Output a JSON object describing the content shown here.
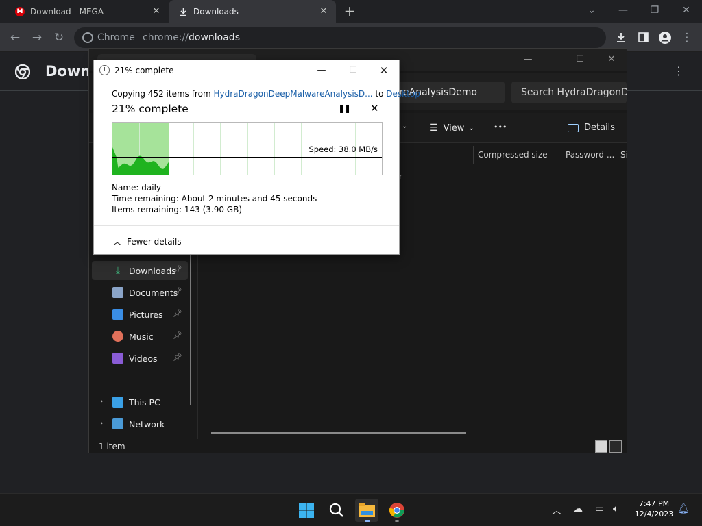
{
  "browser": {
    "tabs": [
      {
        "label": "Download - MEGA",
        "icon": "mega-icon"
      },
      {
        "label": "Downloads",
        "icon": "download-icon"
      }
    ],
    "omnibox": {
      "scheme_label": "Chrome",
      "url_prefix": "chrome://",
      "url_path": "downloads"
    },
    "page_title": "Downl"
  },
  "explorer": {
    "path_partial": "areAnalysisDemo",
    "search_placeholder": "Search HydraDragonDeepM",
    "cmd_view": "View",
    "cmd_more": "•••",
    "cmd_details": "Details",
    "columns": [
      "Compressed size",
      "Password ...",
      "Si"
    ],
    "partial_text": "r",
    "nav": [
      {
        "label": "Downloads",
        "icon": "downloads-folder-icon",
        "pinned": true,
        "color": "#3fb07a"
      },
      {
        "label": "Documents",
        "icon": "documents-folder-icon",
        "pinned": true,
        "color": "#8aa4c8"
      },
      {
        "label": "Pictures",
        "icon": "pictures-folder-icon",
        "pinned": true,
        "color": "#3a8ee6"
      },
      {
        "label": "Music",
        "icon": "music-folder-icon",
        "pinned": true,
        "color": "#e0705a"
      },
      {
        "label": "Videos",
        "icon": "videos-folder-icon",
        "pinned": true,
        "color": "#8a5cd6"
      }
    ],
    "tree": [
      {
        "label": "This PC",
        "icon": "this-pc-icon"
      },
      {
        "label": "Network",
        "icon": "network-icon"
      }
    ],
    "status": "1 item"
  },
  "copy_dialog": {
    "title": "21% complete",
    "copy_prefix": "Copying 452 items from ",
    "source": "HydraDragonDeepMalwareAnalysisD...",
    "copy_mid": " to ",
    "destination": "Desktop",
    "progress_label": "21% complete",
    "progress_fraction": 0.21,
    "speed": "Speed: 38.0 MB/s",
    "name_label": "Name:",
    "name_value": "daily",
    "time_label": "Time remaining:",
    "time_value": "About 2 minutes and 45 seconds",
    "items_label": "Items remaining:",
    "items_value": "143 (3.90 GB)",
    "fewer_details": "Fewer details"
  },
  "taskbar": {
    "apps": [
      {
        "name": "start",
        "icon": "windows-start-icon"
      },
      {
        "name": "search",
        "icon": "search-icon"
      },
      {
        "name": "file-explorer",
        "icon": "file-explorer-icon",
        "active": true
      },
      {
        "name": "chrome",
        "icon": "chrome-icon"
      }
    ],
    "time": "7:47 PM",
    "date": "12/4/2023"
  }
}
